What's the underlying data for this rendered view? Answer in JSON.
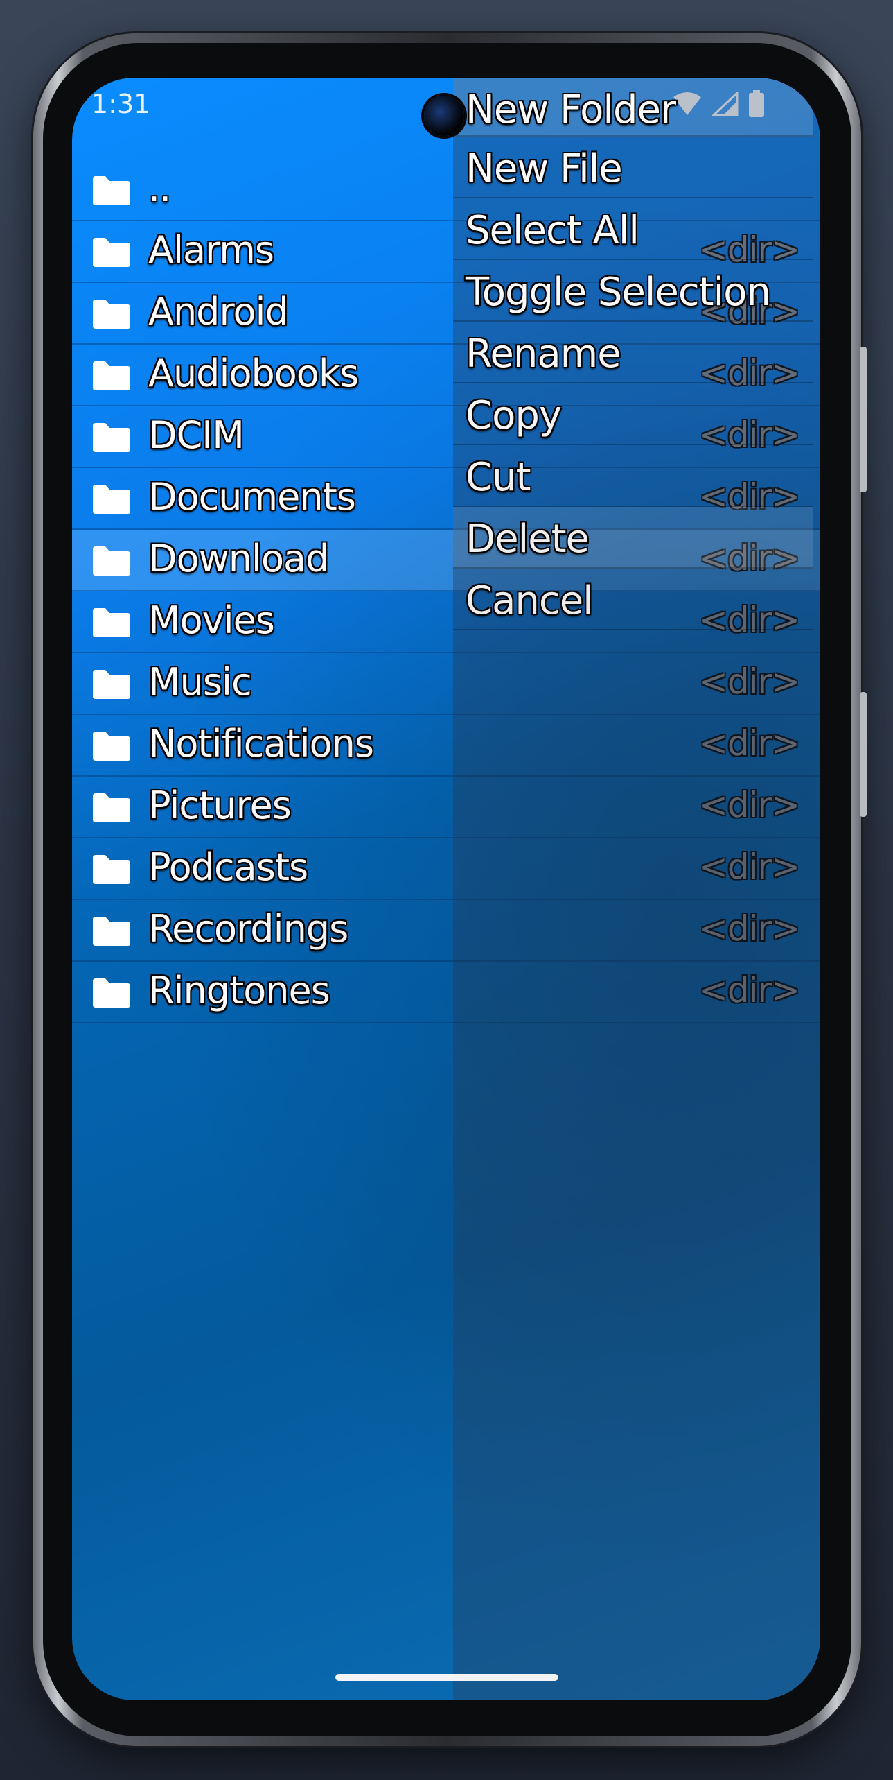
{
  "status": {
    "time": "1:31"
  },
  "files": [
    {
      "name": "..",
      "type": ""
    },
    {
      "name": "Alarms",
      "type": "<dir>"
    },
    {
      "name": "Android",
      "type": "<dir>"
    },
    {
      "name": "Audiobooks",
      "type": "<dir>"
    },
    {
      "name": "DCIM",
      "type": "<dir>"
    },
    {
      "name": "Documents",
      "type": "<dir>"
    },
    {
      "name": "Download",
      "type": "<dir>",
      "selected": true
    },
    {
      "name": "Movies",
      "type": "<dir>"
    },
    {
      "name": "Music",
      "type": "<dir>"
    },
    {
      "name": "Notifications",
      "type": "<dir>"
    },
    {
      "name": "Pictures",
      "type": "<dir>"
    },
    {
      "name": "Podcasts",
      "type": "<dir>"
    },
    {
      "name": "Recordings",
      "type": "<dir>"
    },
    {
      "name": "Ringtones",
      "type": "<dir>"
    }
  ],
  "context_menu": {
    "items": [
      "New Folder",
      "New File",
      "Select All",
      "Toggle Selection",
      "Rename",
      "Copy",
      "Cut",
      "Delete",
      "Cancel"
    ]
  },
  "icons": {
    "folder": "folder-icon",
    "wifi": "wifi-icon",
    "signal": "signal-icon",
    "battery": "battery-icon"
  },
  "colors": {
    "background_top": "#0a8cff",
    "background_bottom": "#045a9c",
    "selected_row": "#78beff",
    "text": "#ffffff",
    "type_text": "#8d8f93"
  }
}
